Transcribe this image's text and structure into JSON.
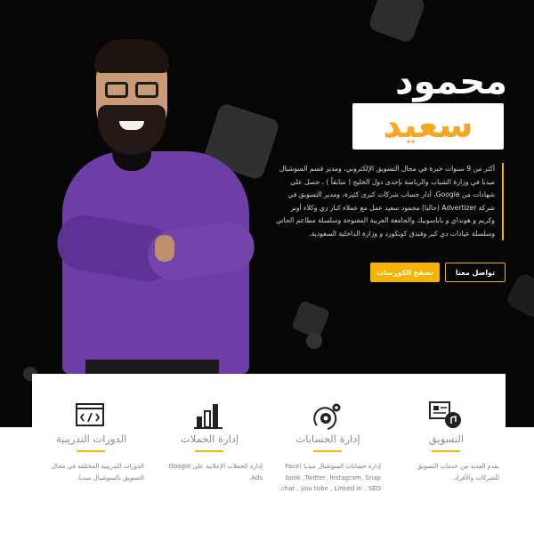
{
  "hero": {
    "name_first": "محمود",
    "name_last": "سعيد",
    "bio": "أكثر من 9 سنوات خبرة في مجال التسويق الإلكتروني، ومدير قسم السوشيال ميديا في وزارة الشباب والرياضة بإحدى دول الخليج ( سابقاً ) ، حصل على شهادات من Google، أدار حساب شركات كبرى كثيرة، ومدير التسويق في شركة Advertizer (حاليا) محمود سعيد عمل مع عملاء كبار زي وكلاء أوبر وكريم و هونداي و باناسونيك والجامعة العربية المفتوحة وسلسلة مطاعم الحاتي وسلسلة عيادات دي كير وفندق كونكورد و وزارة الداخلية السعودية.",
    "contact_label": "تواصل معنا",
    "courses_label": "تصفح الكورسات"
  },
  "services": [
    {
      "icon": "marketing-icon",
      "title": "التسويق",
      "desc": "يقدم العديد من خدمات التسويق للشركات والأفراد."
    },
    {
      "icon": "account-management-icon",
      "title": "إدارة الحسابات",
      "desc": "إدارة حسابات السوشيال ميديا (Face book ,Twitter, Instagram, Snap chat , you tube , Linked in , SEO."
    },
    {
      "icon": "campaigns-icon",
      "title": "إدارة الحملات",
      "desc": "إدارة الحملات الإعلانية على Google Ads."
    },
    {
      "icon": "courses-icon",
      "title": "الدورات التدريبية",
      "desc": "الدورات التدريبية المختلفة في مجال التسويق بالسوشيال ميديا."
    }
  ],
  "colors": {
    "accent": "#f5b400",
    "hero_background": "#060606",
    "shirt": "#6d3ea6"
  }
}
